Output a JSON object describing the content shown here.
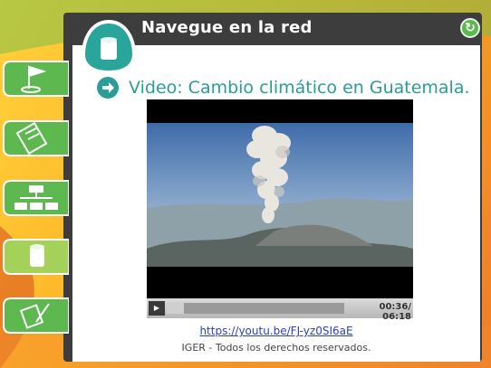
{
  "header": {
    "title": "Navegue en la red"
  },
  "refresh": {
    "icon": "refresh-icon",
    "glyph": "↻"
  },
  "section_icon": "cup-icon",
  "sidebar": {
    "items": [
      {
        "icon": "flag-icon"
      },
      {
        "icon": "checklist-icon"
      },
      {
        "icon": "org-chart-icon"
      },
      {
        "icon": "cup-icon"
      },
      {
        "icon": "pencil-note-icon"
      }
    ]
  },
  "video": {
    "heading": "Video: Cambio climático en Guatemala.",
    "time": "00:36/ 06:18",
    "progress_fraction": 0.095,
    "play_glyph": "▶"
  },
  "footer": {
    "link": "https://youtu.be/FJ-yz0SI6aE",
    "rights": "IGER - Todos los derechos reservados."
  },
  "colors": {
    "accent_teal": "#2a9d96",
    "nav_green": "#5cb84f",
    "link_blue": "#2b42c7"
  }
}
